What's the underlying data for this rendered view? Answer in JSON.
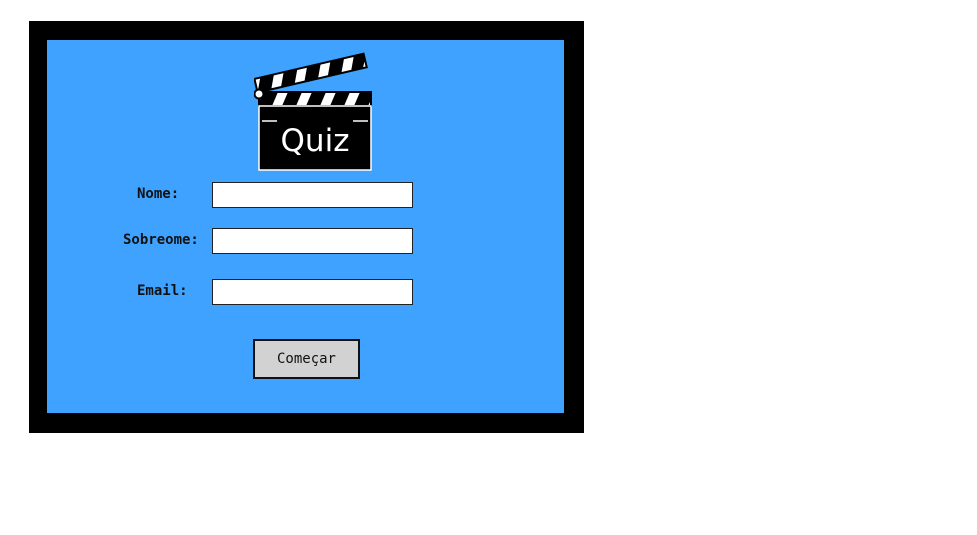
{
  "logo": {
    "title": "Quiz",
    "icon": "clapperboard-icon"
  },
  "form": {
    "fields": [
      {
        "label": "Nome:",
        "value": "",
        "placeholder": ""
      },
      {
        "label": "Sobreome:",
        "value": "",
        "placeholder": ""
      },
      {
        "label": "Email:",
        "value": "",
        "placeholder": ""
      }
    ],
    "submit_label": "Começar"
  },
  "colors": {
    "frame": "#000000",
    "panel": "#3fa2fe",
    "button": "#d2d2d2"
  }
}
